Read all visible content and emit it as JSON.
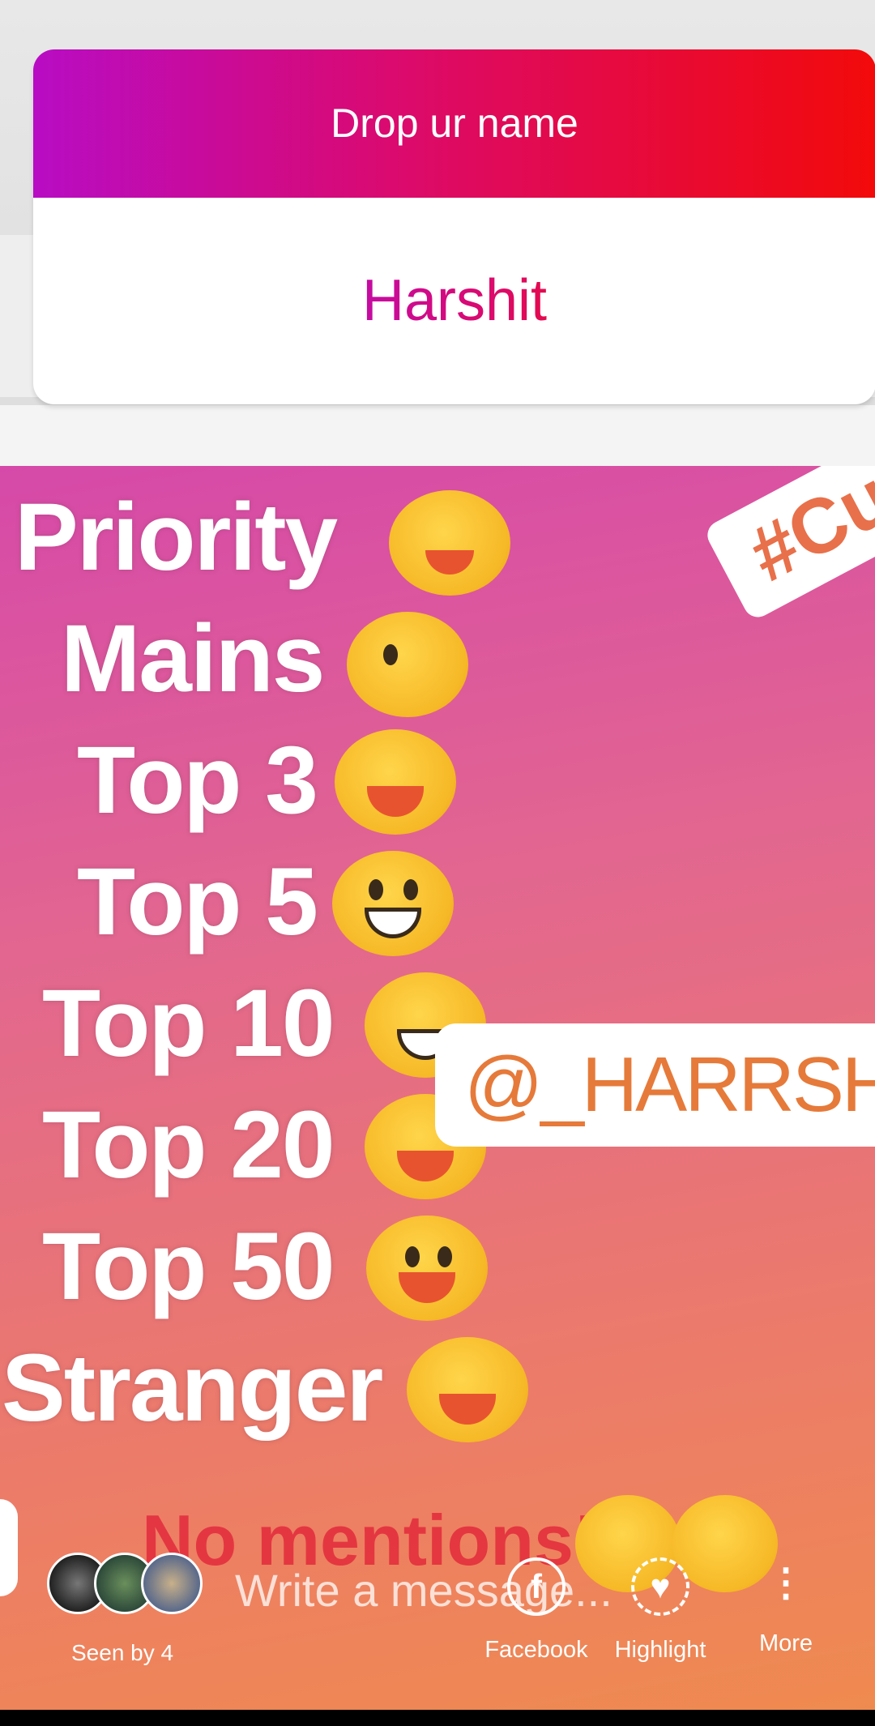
{
  "question_sticker": {
    "prompt": "Drop ur name",
    "answer": "Harshit"
  },
  "story_list": [
    "Priority",
    "Mains",
    "Top 3",
    "Top 5",
    "Top 10",
    "Top 20",
    "Top 50",
    "Stranger"
  ],
  "hashtag_sticker": "#Cu",
  "mention_sticker": "@_HARRSHITT.",
  "overlay_text": "No mentions!",
  "composer_placeholder": "Write a message...",
  "viewers": {
    "label": "Seen by 4",
    "avatar_names": [
      "avatar-wolf",
      "avatar-couple",
      "avatar-person"
    ]
  },
  "actions": [
    {
      "label": "Facebook",
      "icon": "facebook-icon"
    },
    {
      "label": "Highlight",
      "icon": "highlight-heart-icon"
    },
    {
      "label": "More",
      "icon": "more-vertical-icon"
    }
  ],
  "colors": {
    "gradient_start": "#b80cc4",
    "gradient_mid": "#dc0a6a",
    "gradient_end": "#f20a0a"
  }
}
